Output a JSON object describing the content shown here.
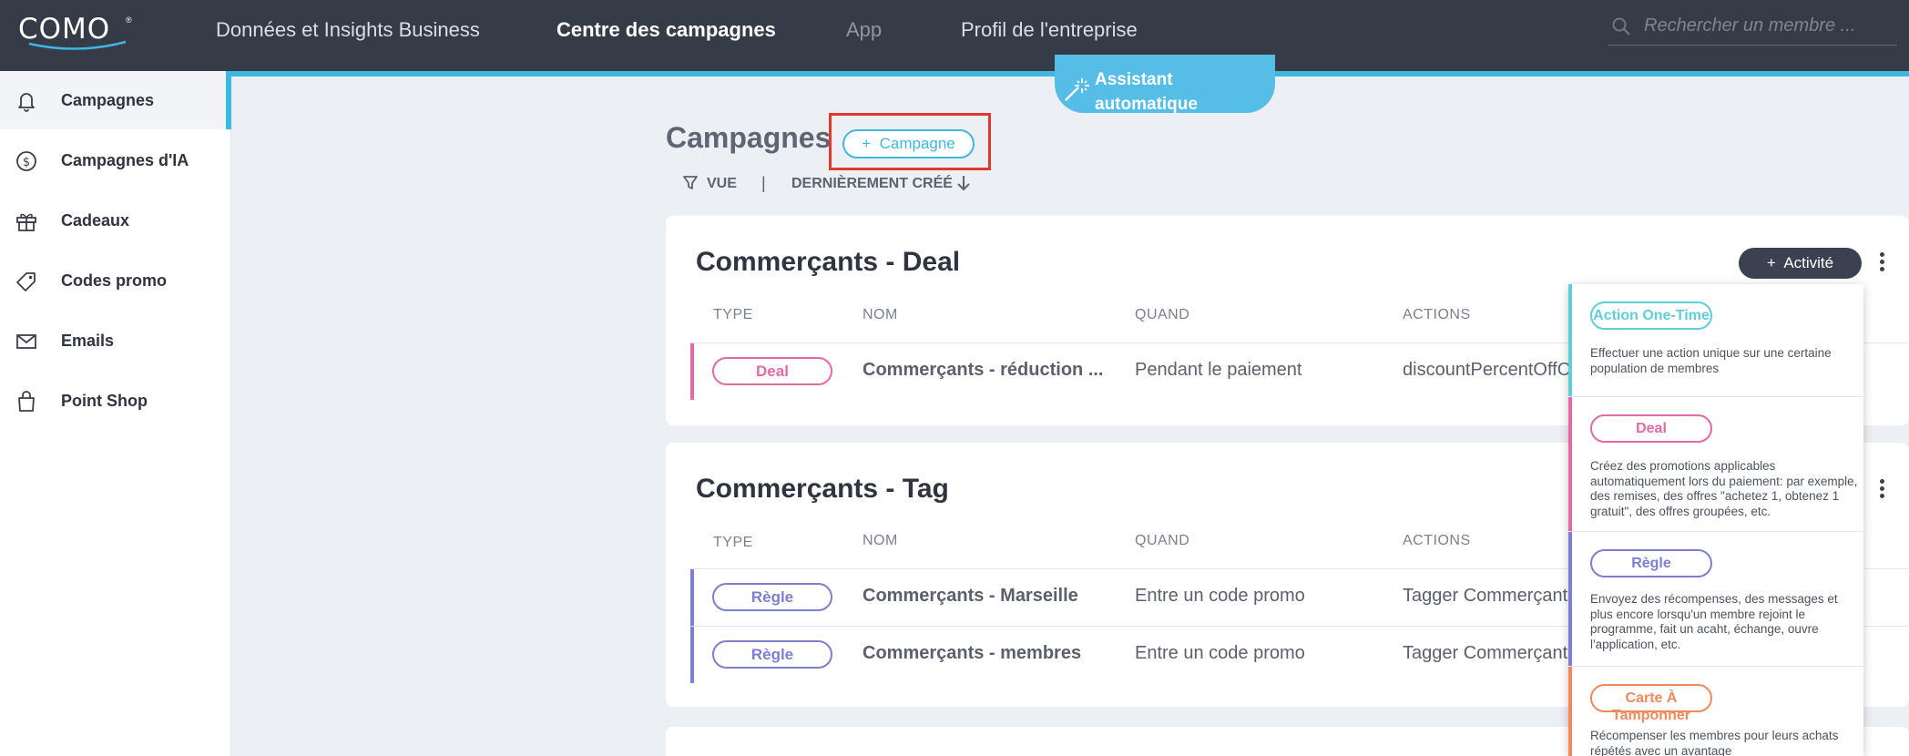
{
  "header": {
    "logo": "COMO",
    "nav": [
      {
        "label": "Données et Insights Business"
      },
      {
        "label": "Centre des campagnes"
      },
      {
        "label": "App"
      },
      {
        "label": "Profil de l'entreprise"
      }
    ],
    "search_placeholder": "Rechercher un membre ..."
  },
  "sidebar": {
    "items": [
      {
        "label": "Campagnes"
      },
      {
        "label": "Campagnes d'IA"
      },
      {
        "label": "Cadeaux"
      },
      {
        "label": "Codes promo"
      },
      {
        "label": "Emails"
      },
      {
        "label": "Point Shop"
      }
    ]
  },
  "assistant": {
    "label": "Assistant automatique"
  },
  "page": {
    "title": "Campagnes",
    "new_button": "Campagne",
    "filter_label": "VUE",
    "separator": "|",
    "sort_label": "DERNIÈREMENT CRÉÉ"
  },
  "columns": {
    "type": "TYPE",
    "name": "NOM",
    "when": "QUAND",
    "actions": "ACTIONS"
  },
  "cards": [
    {
      "title": "Commerçants - Deal",
      "activity_button": "Activité",
      "rows": [
        {
          "type": "Deal",
          "name": "Commerçants - réduction ...",
          "when": "Pendant le paiement",
          "actions": "discountPercentOffO"
        }
      ]
    },
    {
      "title": "Commerçants - Tag",
      "rows": [
        {
          "type": "Règle",
          "name": "Commerçants - Marseille",
          "when": "Entre un code promo",
          "actions": "Tagger Commerçant"
        },
        {
          "type": "Règle",
          "name": "Commerçants - membres",
          "when": "Entre un code promo",
          "actions": "Tagger Commerçant"
        }
      ]
    }
  ],
  "dropdown": {
    "items": [
      {
        "label": "Action One-Time",
        "description": "Effectuer une action unique sur une certaine population de membres"
      },
      {
        "label": "Deal",
        "description": "Créez des promotions applicables automatiquement lors du paiement: par exemple, des remises, des offres \"achetez 1, obtenez 1 gratuit\", des offres groupées, etc."
      },
      {
        "label": "Règle",
        "description": "Envoyez des récompenses, des messages et plus encore lorsqu'un membre rejoint le programme, fait un acaht, échange, ouvre l'application, etc."
      },
      {
        "label": "Carte À Tamponner",
        "description": "Récompenser les membres pour leurs achats répétés avec un avantage"
      }
    ]
  },
  "colors": {
    "accent": "#3eb8e0",
    "deal": "#e26aa8",
    "rule": "#7d7fd0",
    "one_time": "#5fcfd6",
    "punch": "#f08a5d",
    "topbar": "#363c47"
  }
}
